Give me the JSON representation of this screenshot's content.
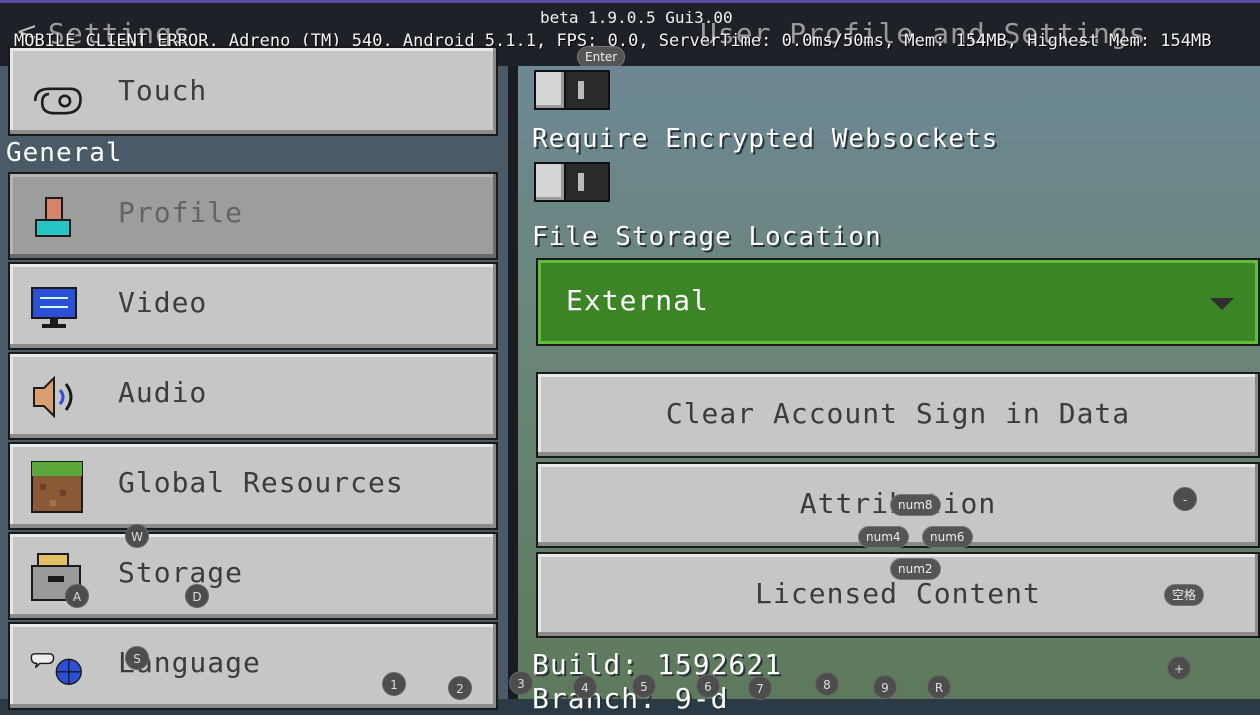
{
  "header": {
    "back_glyph": "<",
    "title_left": "Settings",
    "title_right": "User Profile and Settings",
    "beta": "beta 1.9.0.5 Gui3.00",
    "debug": "MOBILE_CLIENT_ERROR, Adreno (TM) 540, Android 5.1.1, FPS: 0.0, ServerTime: 0.0ms/50ms, Mem: 154MB, Highest Mem: 154MB"
  },
  "sidebar": {
    "items_top": [
      {
        "label": "Touch",
        "icon": "touch-icon"
      }
    ],
    "section_title": "General",
    "items": [
      {
        "label": "Profile",
        "icon": "profile-icon",
        "selected": true
      },
      {
        "label": "Video",
        "icon": "monitor-icon"
      },
      {
        "label": "Audio",
        "icon": "speaker-icon"
      },
      {
        "label": "Global Resources",
        "icon": "grass-block-icon"
      },
      {
        "label": "Storage",
        "icon": "storage-box-icon"
      },
      {
        "label": "Language",
        "icon": "globe-chat-icon"
      }
    ]
  },
  "main": {
    "websockets_label": "Require Encrypted Websockets",
    "storage_label": "File Storage Location",
    "storage_value": "External",
    "buttons": [
      "Clear Account Sign in Data",
      "Attribution",
      "Licensed Content"
    ],
    "build": "Build: 1592621",
    "branch": "Branch: 9-d"
  },
  "overlay_keys": {
    "enter": "Enter",
    "w": "W",
    "a": "A",
    "s": "S",
    "d": "D",
    "num8": "num8",
    "num4": "num4",
    "num6": "num6",
    "num2": "num2",
    "minus": "-",
    "space": "空格",
    "plus": "+",
    "n1": "1",
    "n2": "2",
    "n3": "3",
    "n4": "4",
    "n5": "5",
    "n6": "6",
    "n7": "7",
    "n8": "8",
    "n9": "9",
    "r": "R"
  },
  "colors": {
    "accent_green": "#3c8527",
    "panel_gray": "#c6c6c6",
    "selected_gray": "#9d9d9d"
  }
}
